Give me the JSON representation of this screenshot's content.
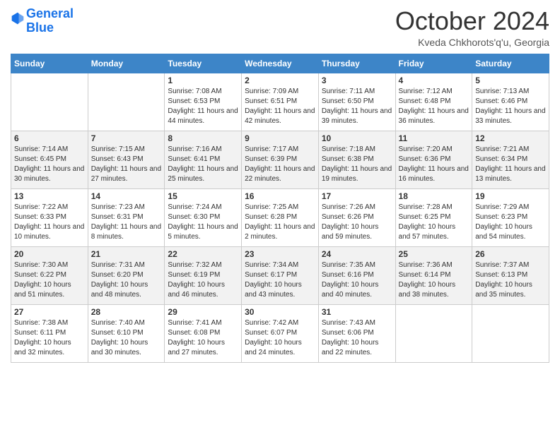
{
  "header": {
    "logo_line1": "General",
    "logo_line2": "Blue",
    "month_title": "October 2024",
    "location": "Kveda Chkhorots'q'u, Georgia"
  },
  "days_of_week": [
    "Sunday",
    "Monday",
    "Tuesday",
    "Wednesday",
    "Thursday",
    "Friday",
    "Saturday"
  ],
  "weeks": [
    [
      {
        "day": null
      },
      {
        "day": null
      },
      {
        "day": 1,
        "sunrise": "Sunrise: 7:08 AM",
        "sunset": "Sunset: 6:53 PM",
        "daylight": "Daylight: 11 hours and 44 minutes."
      },
      {
        "day": 2,
        "sunrise": "Sunrise: 7:09 AM",
        "sunset": "Sunset: 6:51 PM",
        "daylight": "Daylight: 11 hours and 42 minutes."
      },
      {
        "day": 3,
        "sunrise": "Sunrise: 7:11 AM",
        "sunset": "Sunset: 6:50 PM",
        "daylight": "Daylight: 11 hours and 39 minutes."
      },
      {
        "day": 4,
        "sunrise": "Sunrise: 7:12 AM",
        "sunset": "Sunset: 6:48 PM",
        "daylight": "Daylight: 11 hours and 36 minutes."
      },
      {
        "day": 5,
        "sunrise": "Sunrise: 7:13 AM",
        "sunset": "Sunset: 6:46 PM",
        "daylight": "Daylight: 11 hours and 33 minutes."
      }
    ],
    [
      {
        "day": 6,
        "sunrise": "Sunrise: 7:14 AM",
        "sunset": "Sunset: 6:45 PM",
        "daylight": "Daylight: 11 hours and 30 minutes."
      },
      {
        "day": 7,
        "sunrise": "Sunrise: 7:15 AM",
        "sunset": "Sunset: 6:43 PM",
        "daylight": "Daylight: 11 hours and 27 minutes."
      },
      {
        "day": 8,
        "sunrise": "Sunrise: 7:16 AM",
        "sunset": "Sunset: 6:41 PM",
        "daylight": "Daylight: 11 hours and 25 minutes."
      },
      {
        "day": 9,
        "sunrise": "Sunrise: 7:17 AM",
        "sunset": "Sunset: 6:39 PM",
        "daylight": "Daylight: 11 hours and 22 minutes."
      },
      {
        "day": 10,
        "sunrise": "Sunrise: 7:18 AM",
        "sunset": "Sunset: 6:38 PM",
        "daylight": "Daylight: 11 hours and 19 minutes."
      },
      {
        "day": 11,
        "sunrise": "Sunrise: 7:20 AM",
        "sunset": "Sunset: 6:36 PM",
        "daylight": "Daylight: 11 hours and 16 minutes."
      },
      {
        "day": 12,
        "sunrise": "Sunrise: 7:21 AM",
        "sunset": "Sunset: 6:34 PM",
        "daylight": "Daylight: 11 hours and 13 minutes."
      }
    ],
    [
      {
        "day": 13,
        "sunrise": "Sunrise: 7:22 AM",
        "sunset": "Sunset: 6:33 PM",
        "daylight": "Daylight: 11 hours and 10 minutes."
      },
      {
        "day": 14,
        "sunrise": "Sunrise: 7:23 AM",
        "sunset": "Sunset: 6:31 PM",
        "daylight": "Daylight: 11 hours and 8 minutes."
      },
      {
        "day": 15,
        "sunrise": "Sunrise: 7:24 AM",
        "sunset": "Sunset: 6:30 PM",
        "daylight": "Daylight: 11 hours and 5 minutes."
      },
      {
        "day": 16,
        "sunrise": "Sunrise: 7:25 AM",
        "sunset": "Sunset: 6:28 PM",
        "daylight": "Daylight: 11 hours and 2 minutes."
      },
      {
        "day": 17,
        "sunrise": "Sunrise: 7:26 AM",
        "sunset": "Sunset: 6:26 PM",
        "daylight": "Daylight: 10 hours and 59 minutes."
      },
      {
        "day": 18,
        "sunrise": "Sunrise: 7:28 AM",
        "sunset": "Sunset: 6:25 PM",
        "daylight": "Daylight: 10 hours and 57 minutes."
      },
      {
        "day": 19,
        "sunrise": "Sunrise: 7:29 AM",
        "sunset": "Sunset: 6:23 PM",
        "daylight": "Daylight: 10 hours and 54 minutes."
      }
    ],
    [
      {
        "day": 20,
        "sunrise": "Sunrise: 7:30 AM",
        "sunset": "Sunset: 6:22 PM",
        "daylight": "Daylight: 10 hours and 51 minutes."
      },
      {
        "day": 21,
        "sunrise": "Sunrise: 7:31 AM",
        "sunset": "Sunset: 6:20 PM",
        "daylight": "Daylight: 10 hours and 48 minutes."
      },
      {
        "day": 22,
        "sunrise": "Sunrise: 7:32 AM",
        "sunset": "Sunset: 6:19 PM",
        "daylight": "Daylight: 10 hours and 46 minutes."
      },
      {
        "day": 23,
        "sunrise": "Sunrise: 7:34 AM",
        "sunset": "Sunset: 6:17 PM",
        "daylight": "Daylight: 10 hours and 43 minutes."
      },
      {
        "day": 24,
        "sunrise": "Sunrise: 7:35 AM",
        "sunset": "Sunset: 6:16 PM",
        "daylight": "Daylight: 10 hours and 40 minutes."
      },
      {
        "day": 25,
        "sunrise": "Sunrise: 7:36 AM",
        "sunset": "Sunset: 6:14 PM",
        "daylight": "Daylight: 10 hours and 38 minutes."
      },
      {
        "day": 26,
        "sunrise": "Sunrise: 7:37 AM",
        "sunset": "Sunset: 6:13 PM",
        "daylight": "Daylight: 10 hours and 35 minutes."
      }
    ],
    [
      {
        "day": 27,
        "sunrise": "Sunrise: 7:38 AM",
        "sunset": "Sunset: 6:11 PM",
        "daylight": "Daylight: 10 hours and 32 minutes."
      },
      {
        "day": 28,
        "sunrise": "Sunrise: 7:40 AM",
        "sunset": "Sunset: 6:10 PM",
        "daylight": "Daylight: 10 hours and 30 minutes."
      },
      {
        "day": 29,
        "sunrise": "Sunrise: 7:41 AM",
        "sunset": "Sunset: 6:08 PM",
        "daylight": "Daylight: 10 hours and 27 minutes."
      },
      {
        "day": 30,
        "sunrise": "Sunrise: 7:42 AM",
        "sunset": "Sunset: 6:07 PM",
        "daylight": "Daylight: 10 hours and 24 minutes."
      },
      {
        "day": 31,
        "sunrise": "Sunrise: 7:43 AM",
        "sunset": "Sunset: 6:06 PM",
        "daylight": "Daylight: 10 hours and 22 minutes."
      },
      {
        "day": null
      },
      {
        "day": null
      }
    ]
  ]
}
